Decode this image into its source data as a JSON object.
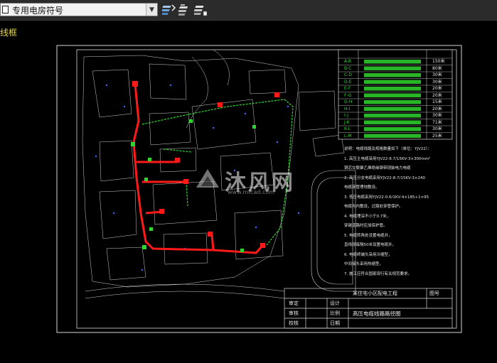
{
  "toolbar": {
    "layer_name": "专用电房符号",
    "icons": [
      "layer-state-icon",
      "layer-previous-icon",
      "layer-match-icon"
    ]
  },
  "menu": {
    "label": "线框"
  },
  "colors": {
    "background": "#000000",
    "cable_red": "#ff1a1a",
    "cable_green": "#2fd62f",
    "linework_white": "#d8d8d8",
    "accent_yellow": "#e8d44d"
  },
  "legend_table": {
    "rows": [
      {
        "id": "A-B",
        "len": "150米"
      },
      {
        "id": "B-C",
        "len": "80米"
      },
      {
        "id": "C-D",
        "len": "30米"
      },
      {
        "id": "D-E",
        "len": "30米"
      },
      {
        "id": "E-F",
        "len": "20米"
      },
      {
        "id": "F-G",
        "len": "20米"
      },
      {
        "id": "G-H",
        "len": "15米"
      },
      {
        "id": "H-I",
        "len": "20米"
      },
      {
        "id": "I-J",
        "len": "30米"
      },
      {
        "id": "J-K",
        "len": "71米"
      },
      {
        "id": "K-L",
        "len": "30米"
      },
      {
        "id": "L-M",
        "len": "25米"
      }
    ]
  },
  "notes": [
    "说明：电缆线路及规格数量如下（单位：YJV22）：",
    "1. 高压主电缆采用YJV22-8.7/15KV-3×300mm²",
    "   铜芯交联聚乙烯绝缘钢带铠装电力电缆",
    "2. 高压分支电缆采用YJV22-8.7/15KV-3×240",
    "   电缆穿管埋地敷设。",
    "3. 低压电缆采用YJV22-0.6/1KV-4×185+1×95",
    "   电缆沟内敷设，过路处穿管保护。",
    "4. 电缆埋深不小于0.7米，",
    "   穿越道路时应加保护管。",
    "5. 电缆转角处设置电缆井，",
    "   直线段每隔50米设置电缆井。",
    "6. 电缆终端头采用冷缩型，",
    "   中间接头采用热缩型。",
    "7. 施工应符合国家现行有关规范要求。"
  ],
  "title_block": {
    "drawing_title": "高压电缆线路路径图",
    "labels": [
      "审定",
      "审核",
      "校核",
      "设计",
      "比例",
      "日期",
      "图号"
    ],
    "project": "某住宅小区配电工程"
  },
  "watermark": {
    "text": "沐风网",
    "url": "www.mfcad.com"
  }
}
